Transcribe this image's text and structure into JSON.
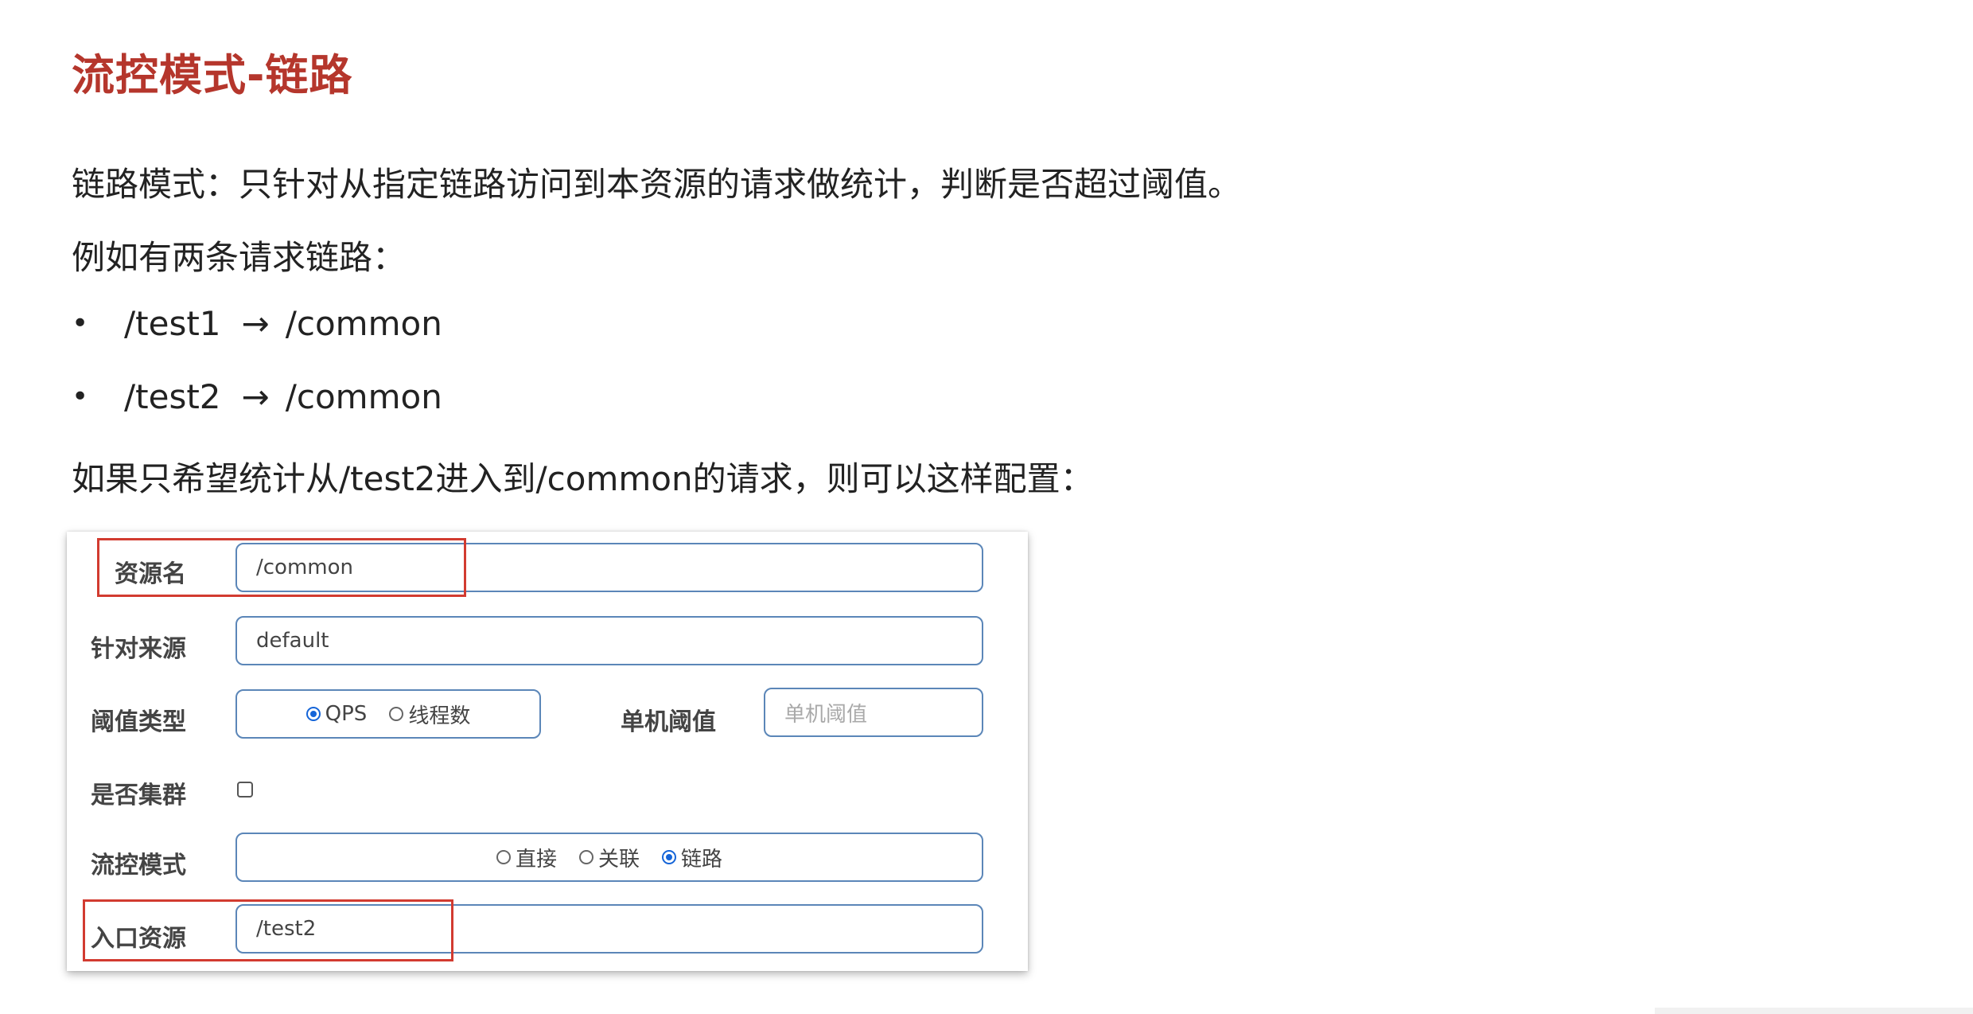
{
  "slide": {
    "title": "流控模式-链路",
    "intro": "链路模式：只针对从指定链路访问到本资源的请求做统计，判断是否超过阈值。",
    "example_intro": "例如有两条请求链路：",
    "bullet_char": "•",
    "arrow_char": "→",
    "chains": [
      {
        "from": "/test1",
        "to": "/common"
      },
      {
        "from": "/test2",
        "to": "/common"
      }
    ],
    "conclusion": "如果只希望统计从/test2进入到/common的请求，则可以这样配置："
  },
  "form": {
    "resource_name": {
      "label": "资源名",
      "value": "/common"
    },
    "limit_app": {
      "label": "针对来源",
      "value": "default"
    },
    "threshold_type": {
      "label": "阈值类型",
      "options": [
        {
          "label": "QPS",
          "checked": true
        },
        {
          "label": "线程数",
          "checked": false
        }
      ]
    },
    "single_threshold": {
      "label": "单机阈值",
      "placeholder": "单机阈值"
    },
    "cluster": {
      "label": "是否集群",
      "checked": false
    },
    "flow_mode": {
      "label": "流控模式",
      "options": [
        {
          "label": "直接",
          "checked": false
        },
        {
          "label": "关联",
          "checked": false
        },
        {
          "label": "链路",
          "checked": true
        }
      ]
    },
    "entry_resource": {
      "label": "入口资源",
      "value": "/test2"
    }
  },
  "colors": {
    "title": "#b5362c",
    "highlight": "#d23b30",
    "input_border": "#5b86b8",
    "radio_checked": "#1565d8"
  }
}
